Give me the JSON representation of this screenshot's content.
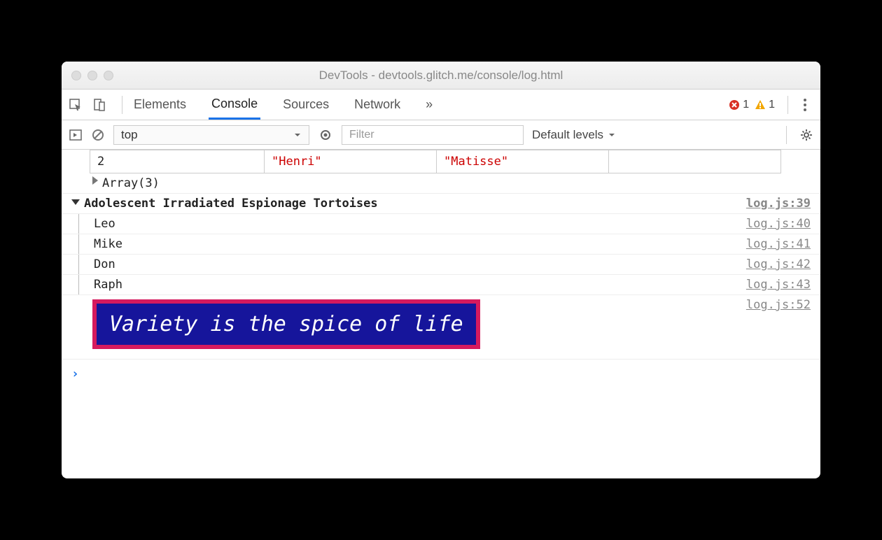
{
  "window": {
    "title": "DevTools - devtools.glitch.me/console/log.html"
  },
  "tabs": {
    "items": [
      "Elements",
      "Console",
      "Sources",
      "Network"
    ],
    "active_index": 1,
    "more_indicator": "»"
  },
  "counts": {
    "errors": "1",
    "warnings": "1"
  },
  "toolbar": {
    "context": "top",
    "filter_placeholder": "Filter",
    "levels_label": "Default levels"
  },
  "console": {
    "table_row": {
      "index": "2",
      "first": "\"Henri\"",
      "last": "\"Matisse\""
    },
    "array_summary": "Array(3)",
    "group": {
      "title": "Adolescent Irradiated Espionage Tortoises",
      "src": "log.js:39",
      "items": [
        {
          "text": "Leo",
          "src": "log.js:40"
        },
        {
          "text": "Mike",
          "src": "log.js:41"
        },
        {
          "text": "Don",
          "src": "log.js:42"
        },
        {
          "text": "Raph",
          "src": "log.js:43"
        }
      ]
    },
    "styled": {
      "text": "Variety is the spice of life",
      "src": "log.js:52",
      "style": {
        "background": "#16159b",
        "color": "#ffffff",
        "border_color": "#d61a5e"
      }
    },
    "prompt": "›"
  }
}
